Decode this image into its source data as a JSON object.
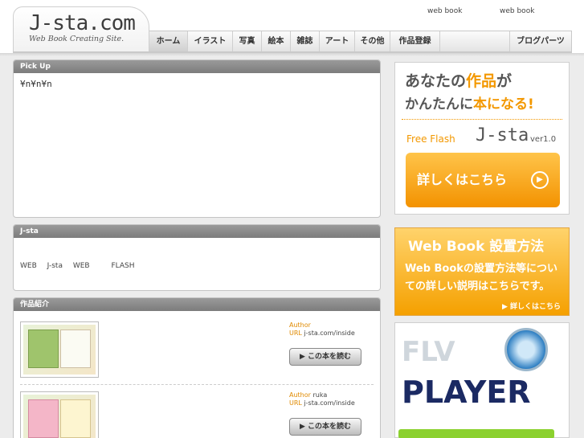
{
  "header": {
    "logo_main": "J-sta",
    "logo_dot": ".",
    "logo_tld": "com",
    "tagline": "Web Book Creating Site.",
    "top_links": [
      "web book",
      "web book"
    ]
  },
  "nav": {
    "items": [
      "ホーム",
      "イラスト",
      "写真",
      "絵本",
      "雑誌",
      "アート",
      "その他",
      "作品登録"
    ],
    "right_item": "ブログパーツ",
    "active_index": 0
  },
  "pickup": {
    "title": "Pick Up",
    "body": "¥n¥n¥n"
  },
  "jsta": {
    "title": "J-sta",
    "words": [
      "WEB",
      "J-sta",
      "WEB",
      "FLASH"
    ]
  },
  "works": {
    "title": "作品紹介",
    "items": [
      {
        "author_label": "Author",
        "author": "",
        "url_label": "URL",
        "url": "j-sta.com/inside",
        "button": "この本を読む"
      },
      {
        "author_label": "Author",
        "author": "ruka",
        "url_label": "URL",
        "url": "j-sta.com/inside",
        "button": "この本を読む"
      }
    ]
  },
  "sidebar": {
    "ad1": {
      "line1_a": "あなたの",
      "line1_b": "作品",
      "line1_c": "が",
      "line2_a": "かんたんに",
      "line2_b": "本になる!",
      "free_flash": "Free Flash",
      "product": "J-sta",
      "version": "ver1.0",
      "cta": "詳しくはこちら"
    },
    "ad2": {
      "title": "Web Book 設置方法",
      "text": "Web Bookの設置方法等についての詳しい説明はこちらです。",
      "link": "▶ 詳しくはこちら"
    },
    "ad3": {
      "line1": "FLV",
      "line2": "PLAYER"
    }
  },
  "colors": {
    "accent_orange": "#f39800",
    "panel_header": "#8a8a8a",
    "player_navy": "#1b2a63"
  }
}
